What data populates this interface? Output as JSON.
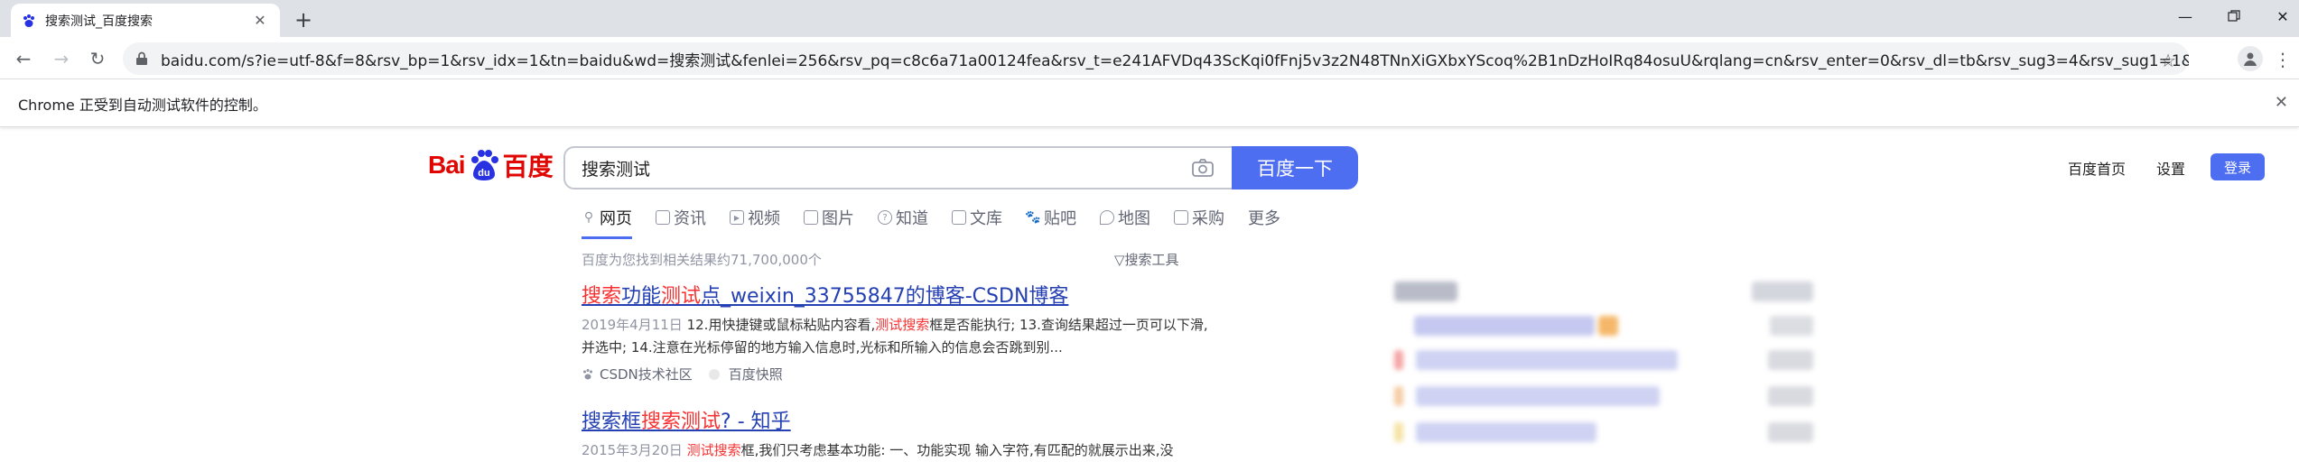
{
  "browser": {
    "tab_title": "搜索测试_百度搜索",
    "url": "baidu.com/s?ie=utf-8&f=8&rsv_bp=1&rsv_idx=1&tn=baidu&wd=搜索测试&fenlei=256&rsv_pq=c8c6a71a00124fea&rsv_t=e241AFVDq43ScKqi0fFnj5v3z2N48TNnXiGXbxYScoq%2B1nDzHoIRq84osuU&rqlang=cn&rsv_enter=0&rsv_dl=tb&rsv_sug3=4&rsv_sug1=1&r...",
    "infobar_text": "Chrome 正受到自动测试软件的控制。"
  },
  "baidu": {
    "logo_bai": "Bai",
    "logo_du": "百度",
    "query": "搜索测试",
    "search_button": "百度一下",
    "nav_home": "百度首页",
    "nav_settings": "设置",
    "nav_login": "登录",
    "tabs": [
      "网页",
      "资讯",
      "视频",
      "图片",
      "知道",
      "文库",
      "贴吧",
      "地图",
      "采购",
      "更多"
    ],
    "result_count": "百度为您找到相关结果约71,700,000个",
    "tools": "搜索工具"
  },
  "results": [
    {
      "title_parts": [
        "搜索",
        "功能",
        "测试",
        "点_weixin_33755847的博客-CSDN博客"
      ],
      "date": "2019年4月11日",
      "abs_a": "12.用快捷键或鼠标粘贴内容看,",
      "abs_hl": "测试搜索",
      "abs_b": "框是否能执行; 13.查询结果超过一页可以下滑,并选中; 14.注意在光标停留的地方输入信息时,光标和所输入的信息会否跳到别...",
      "source": "CSDN技术社区",
      "snapshot": "百度快照"
    },
    {
      "title_parts": [
        "搜索框",
        "搜索测试",
        "? - 知乎"
      ],
      "date": "2015年3月20日",
      "abs_hl": "测试搜索",
      "abs_b": "框,我们只考虑基本功能: 一、功能实现 输入字符,有匹配的就展示出来,没"
    }
  ],
  "colors": {
    "accent": "#4e6ef2",
    "link": "#2440b3",
    "highlight": "#f73131"
  }
}
